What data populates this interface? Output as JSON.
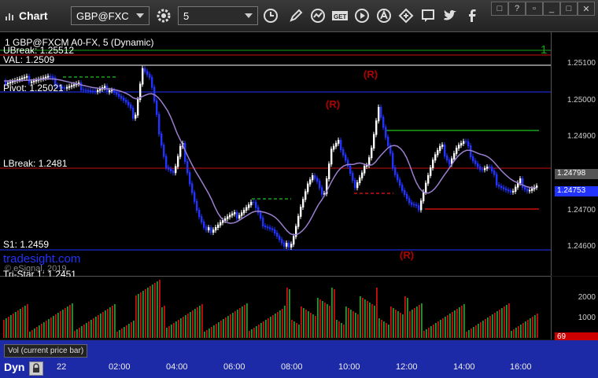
{
  "toolbar": {
    "title": "Chart",
    "symbol": "GBP@FXC",
    "interval": "5"
  },
  "chart": {
    "study_label": "1 GBP@FXCM A0-FX, 5 (Dynamic)",
    "levels": {
      "ubreak": "UBreak: 1.25512",
      "val": "VAL: 1.2509",
      "pivot": "Pivot: 1.25021",
      "lbreak": "LBreak: 1.2481",
      "s1": "S1: 1.2459",
      "tristar": "Tri-Star 1: 1.2451"
    },
    "watermark": "tradesight.com",
    "copyright": "© eSignal, 2019",
    "r_marker": "(R)",
    "price_current": "1.24753",
    "price_ma": "1.24798",
    "y_ticks": [
      "1.25100",
      "1.25000",
      "1.24900",
      "1.24800",
      "1.24700",
      "1.24600"
    ],
    "top_right_marker": "1",
    "colors": {
      "up": "#ffffff",
      "down": "#2233ff",
      "ma": "#9a7fd0",
      "green": "#1aa31a",
      "red": "#cc1010",
      "blue": "#2233ff"
    }
  },
  "volume": {
    "label": "Vol (current price bar)",
    "y_ticks": [
      "2000",
      "1000"
    ],
    "current": "69"
  },
  "xaxis": {
    "mode": "Dyn",
    "ticks": [
      "22",
      "02:00",
      "04:00",
      "06:00",
      "08:00",
      "10:00",
      "12:00",
      "14:00",
      "16:00"
    ]
  }
}
